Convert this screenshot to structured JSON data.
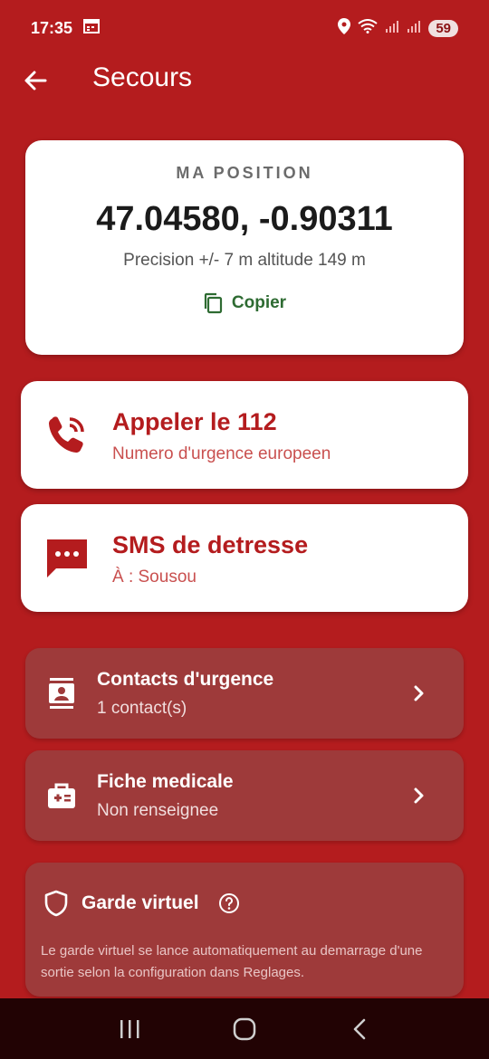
{
  "status": {
    "time": "17:35",
    "battery": "59"
  },
  "header": {
    "title": "Secours"
  },
  "position": {
    "label": "MA POSITION",
    "coords": "47.04580, -0.90311",
    "precision": "Precision +/- 7 m  altitude 149 m",
    "copy_label": "Copier"
  },
  "call": {
    "title": "Appeler le 112",
    "subtitle": "Numero d'urgence europeen"
  },
  "sms": {
    "title": "SMS de detresse",
    "subtitle": "À : Sousou"
  },
  "contacts": {
    "title": "Contacts d'urgence",
    "subtitle": "1 contact(s)"
  },
  "medical": {
    "title": "Fiche medicale",
    "subtitle": "Non renseignee"
  },
  "guard": {
    "title": "Garde virtuel",
    "text": "Le garde virtuel se lance automatiquement au demarrage d'une sortie selon la configuration dans Reglages."
  },
  "icons": {
    "back": "arrow-left-icon",
    "copy": "copy-icon",
    "call": "phone-ringing-icon",
    "sms": "sms-icon",
    "contacts": "contact-card-icon",
    "medical": "medical-kit-icon",
    "guard": "shield-icon",
    "help": "help-circle-icon"
  },
  "colors": {
    "background": "#b41c1e",
    "accent_red": "#b41c1e",
    "copy_green": "#2e6b32",
    "dark_card": "#9e3a3a"
  }
}
